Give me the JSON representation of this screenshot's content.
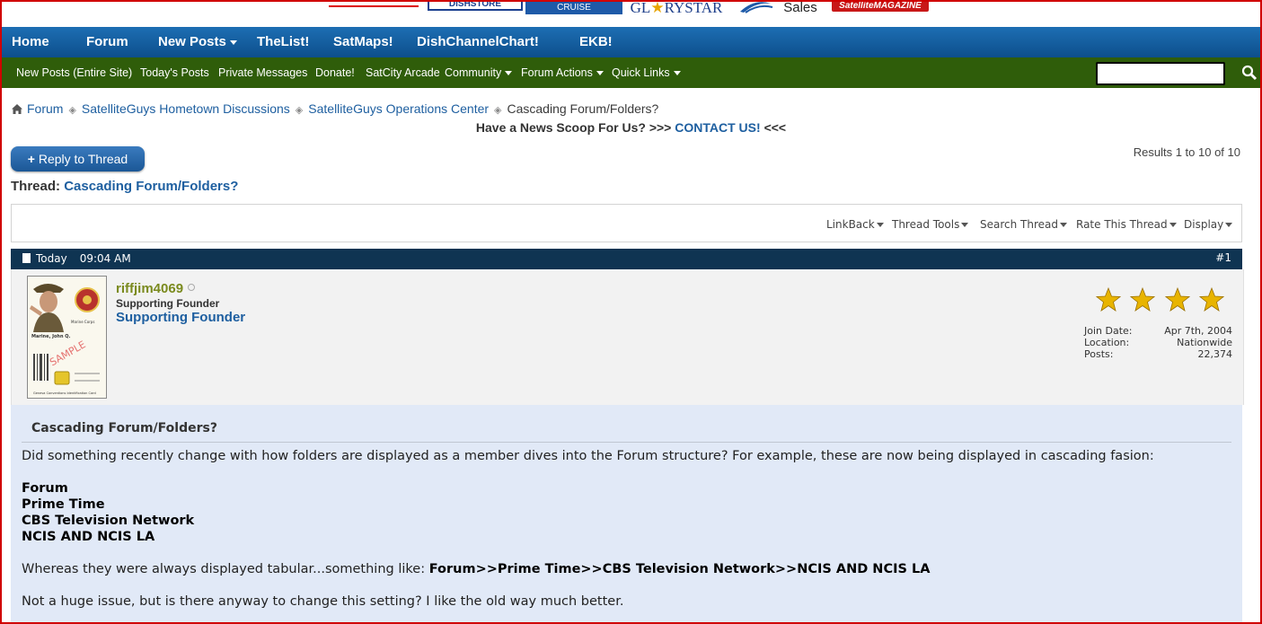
{
  "banner": {
    "logos": {
      "dish": "DISHSTORE",
      "cruise": "CRUISE",
      "glory_a": "GL",
      "glory_b": "RYSTAR",
      "sales": "Sales",
      "magazine": "SatelliteMAGAZINE"
    }
  },
  "main_nav": {
    "items": [
      "Home",
      "Forum",
      "New Posts",
      "TheList!",
      "SatMaps!",
      "DishChannelChart!",
      "EKB!"
    ]
  },
  "sub_nav": {
    "items": [
      "New Posts (Entire Site)",
      "Today's Posts",
      "Private Messages",
      "Donate!",
      "SatCity Arcade",
      "Community",
      "Forum Actions",
      "Quick Links"
    ],
    "search_placeholder": ""
  },
  "breadcrumb": {
    "items": [
      "Forum",
      "SatelliteGuys Hometown Discussions",
      "SatelliteGuys Operations Center",
      "Cascading Forum/Folders?"
    ]
  },
  "scoop": {
    "prefix": "Have a News Scoop For Us? >>>",
    "link": "CONTACT US!",
    "suffix": "<<<"
  },
  "reply_button": {
    "plus": "+",
    "label": "Reply to Thread"
  },
  "results_text": "Results 1 to 10 of 10",
  "thread": {
    "label": "Thread:",
    "title": "Cascading Forum/Folders?"
  },
  "tools": [
    "LinkBack",
    "Thread Tools",
    "Search Thread",
    "Rate This Thread",
    "Display"
  ],
  "post": {
    "day": "Today",
    "time": "09:04 AM",
    "number": "#1",
    "username": "riffjim4069",
    "user_title": "Supporting Founder",
    "rank_label": "Supporting Founder",
    "stars": 4,
    "stats": [
      {
        "label": "Join Date:",
        "value": "Apr 7th, 2004"
      },
      {
        "label": "Location:",
        "value": "Nationwide"
      },
      {
        "label": "Posts:",
        "value": "22,374"
      }
    ],
    "title": "Cascading Forum/Folders?",
    "para1": "Did something recently change with how folders are displayed as a member dives into the Forum structure? For example, these are now being displayed in cascading fasion:",
    "list": [
      "Forum",
      "Prime Time",
      "CBS Television Network",
      "NCIS AND NCIS LA"
    ],
    "para2_prefix": "Whereas they were always displayed tabular...something like: ",
    "para2_bold": "Forum>>Prime Time>>CBS Television Network>>NCIS AND NCIS LA",
    "para3": "Not a huge issue, but is there anyway to change this setting? I like the old way much better."
  },
  "avatar": {
    "name_text": "Marine, John Q.",
    "stamp": "SAMPLE",
    "branch": "Marine Corps",
    "footer": "Geneva Conventions Identification Card"
  },
  "colors": {
    "main_nav": "#1d6eb3",
    "sub_nav": "#2f5d0a",
    "post_header": "#0f3452",
    "post_body": "#e1e9f7",
    "link": "#1e5fa0",
    "frame": "#d00000"
  }
}
